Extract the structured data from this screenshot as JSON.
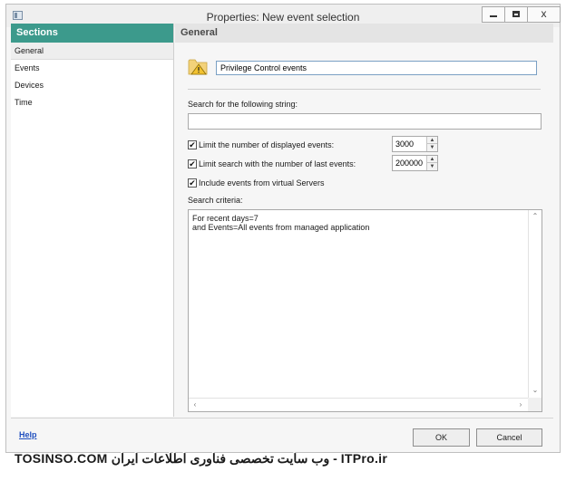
{
  "window": {
    "title": "Properties: New event selection",
    "controls": {
      "minimize_icon": "minimize-icon",
      "maximize_icon": "maximize-icon",
      "close_label": "x"
    }
  },
  "sidebar": {
    "header": "Sections",
    "items": [
      {
        "label": "General",
        "active": true
      },
      {
        "label": "Events",
        "active": false
      },
      {
        "label": "Devices",
        "active": false
      },
      {
        "label": "Time",
        "active": false
      }
    ]
  },
  "content": {
    "header": "General",
    "name_icon": "folder-warning-icon",
    "name_value": "Privilege Control events",
    "search_label": "Search for the following string:",
    "search_value": "",
    "limit_displayed": {
      "label": "Limit the number of displayed events:",
      "checked": true,
      "value": "3000"
    },
    "limit_last": {
      "label": "Limit search with the number of last events:",
      "checked": true,
      "value": "200000"
    },
    "include_virtual": {
      "label": "Include events from virtual Servers",
      "checked": true
    },
    "criteria_label": "Search criteria:",
    "criteria_text": "For recent days=7\nand Events=All events from managed application"
  },
  "footer": {
    "help_label": "Help",
    "ok_label": "OK",
    "cancel_label": "Cancel"
  },
  "watermark": {
    "text": "TOSINSO.COM وب سایت تخصصی فناوری اطلاعات ایران - ITPro.ir"
  },
  "colors": {
    "sidebar_header": "#3c9a8c",
    "content_header": "#e4e4e4",
    "help_link": "#1f4fbf"
  }
}
